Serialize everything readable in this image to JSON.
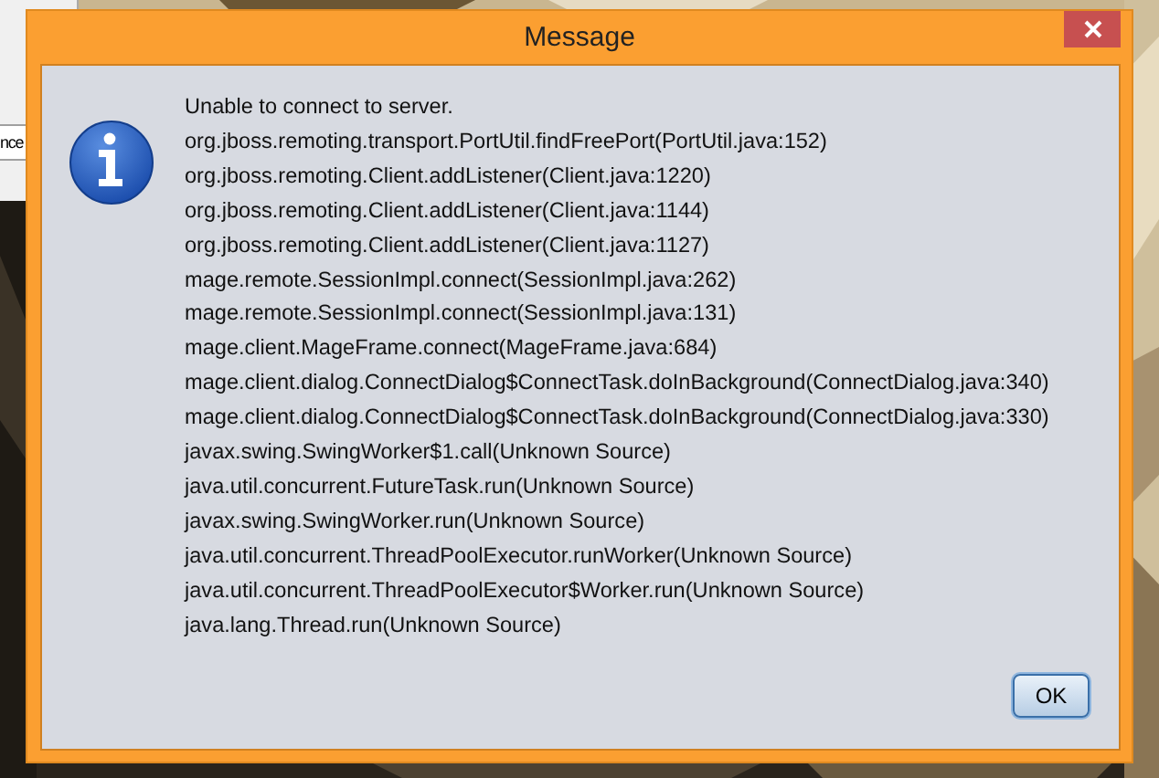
{
  "background_app": {
    "field_text": "nce"
  },
  "window": {
    "title": "Message"
  },
  "message": {
    "kind": "info",
    "lines": [
      "Unable to connect to server.",
      "org.jboss.remoting.transport.PortUtil.findFreePort(PortUtil.java:152)",
      "org.jboss.remoting.Client.addListener(Client.java:1220)",
      "org.jboss.remoting.Client.addListener(Client.java:1144)",
      "org.jboss.remoting.Client.addListener(Client.java:1127)",
      "mage.remote.SessionImpl.connect(SessionImpl.java:262)",
      "mage.remote.SessionImpl.connect(SessionImpl.java:131)",
      "mage.client.MageFrame.connect(MageFrame.java:684)",
      "mage.client.dialog.ConnectDialog$ConnectTask.doInBackground(ConnectDialog.java:340)",
      "mage.client.dialog.ConnectDialog$ConnectTask.doInBackground(ConnectDialog.java:330)",
      "javax.swing.SwingWorker$1.call(Unknown Source)",
      "java.util.concurrent.FutureTask.run(Unknown Source)",
      "javax.swing.SwingWorker.run(Unknown Source)",
      "java.util.concurrent.ThreadPoolExecutor.runWorker(Unknown Source)",
      "java.util.concurrent.ThreadPoolExecutor$Worker.run(Unknown Source)",
      "java.lang.Thread.run(Unknown Source)"
    ]
  },
  "buttons": [
    "OK"
  ]
}
